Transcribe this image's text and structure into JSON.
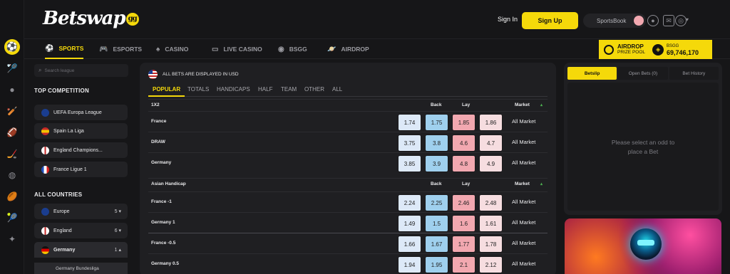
{
  "header": {
    "logo_text": "Betswap",
    "logo_badge": "gg",
    "sign_in": "Sign In",
    "sign_up": "Sign Up",
    "sportsbook": "SportsBook"
  },
  "nav": {
    "tabs": [
      {
        "label": "SPORTS",
        "icon": "soccer-ball-icon"
      },
      {
        "label": "ESPORTS",
        "icon": "gamepad-icon"
      },
      {
        "label": "CASINO",
        "icon": "cards-icon"
      },
      {
        "label": "LIVE CASINO",
        "icon": "tv-icon"
      },
      {
        "label": "BSGG",
        "icon": "coin-icon"
      },
      {
        "label": "AIRDROP",
        "icon": "planet-icon"
      }
    ],
    "airdrop_title": "AIRDROP",
    "airdrop_sub": "PRIZE POOL",
    "bsgg_label": "BSGG",
    "bsgg_value": "69,746,170"
  },
  "sidebar": {
    "search_placeholder": "Search league",
    "top_competition_title": "TOP COMPETITION",
    "leagues": [
      {
        "name": "UEFA Europa League",
        "flag": "eu"
      },
      {
        "name": "Spain La Liga",
        "flag": "es"
      },
      {
        "name": "England Champions...",
        "flag": "en"
      },
      {
        "name": "France Ligue 1",
        "flag": "fr"
      }
    ],
    "all_countries_title": "ALL COUNTRIES",
    "countries": [
      {
        "name": "Europe",
        "count": "5",
        "flag": "eu",
        "chevron": "▾"
      },
      {
        "name": "England",
        "count": "6",
        "flag": "en",
        "chevron": "▾"
      },
      {
        "name": "Germany",
        "count": "1",
        "flag": "de",
        "chevron": "▴"
      }
    ],
    "sub_league": "Germany Bundesliga"
  },
  "market": {
    "currency_note": "ALL BETS ARE DISPLAYED IN USD",
    "tabs": [
      "POPULAR",
      "TOTALS",
      "HANDICAPS",
      "HALF",
      "TEAM",
      "OTHER",
      "ALL"
    ],
    "col_back": "Back",
    "col_lay": "Lay",
    "col_market": "Market",
    "groups": [
      {
        "title": "1X2",
        "rows": [
          {
            "name": "France",
            "odds": [
              "1.74",
              "1.75",
              "1.85",
              "1.86"
            ],
            "market": "All Market"
          },
          {
            "name": "DRAW",
            "odds": [
              "3.75",
              "3.8",
              "4.6",
              "4.7"
            ],
            "market": "All Market"
          },
          {
            "name": "Germany",
            "odds": [
              "3.85",
              "3.9",
              "4.8",
              "4.9"
            ],
            "market": "All Market"
          }
        ]
      },
      {
        "title": "Asian Handicap",
        "rows": [
          {
            "name": "France -1",
            "odds": [
              "2.24",
              "2.25",
              "2.46",
              "2.48"
            ],
            "market": "All Market"
          },
          {
            "name": "Germany 1",
            "odds": [
              "1.49",
              "1.5",
              "1.6",
              "1.61"
            ],
            "market": "All Market"
          },
          {
            "name": "France -0.5",
            "odds": [
              "1.66",
              "1.67",
              "1.77",
              "1.78"
            ],
            "market": "All Market"
          },
          {
            "name": "Germany 0.5",
            "odds": [
              "1.94",
              "1.95",
              "2.1",
              "2.12"
            ],
            "market": "All Market"
          }
        ]
      }
    ]
  },
  "betslip": {
    "tabs": [
      "Betslip",
      "Open Bets (0)",
      "Bet History"
    ],
    "empty_line1": "Please select an odd to",
    "empty_line2": "place a Bet"
  },
  "colors": {
    "accent": "#f5d90a",
    "back_light": "#dde9f8",
    "back_dark": "#9fd0ee",
    "lay_dark": "#f2a8b0",
    "lay_light": "#f6dde0"
  }
}
